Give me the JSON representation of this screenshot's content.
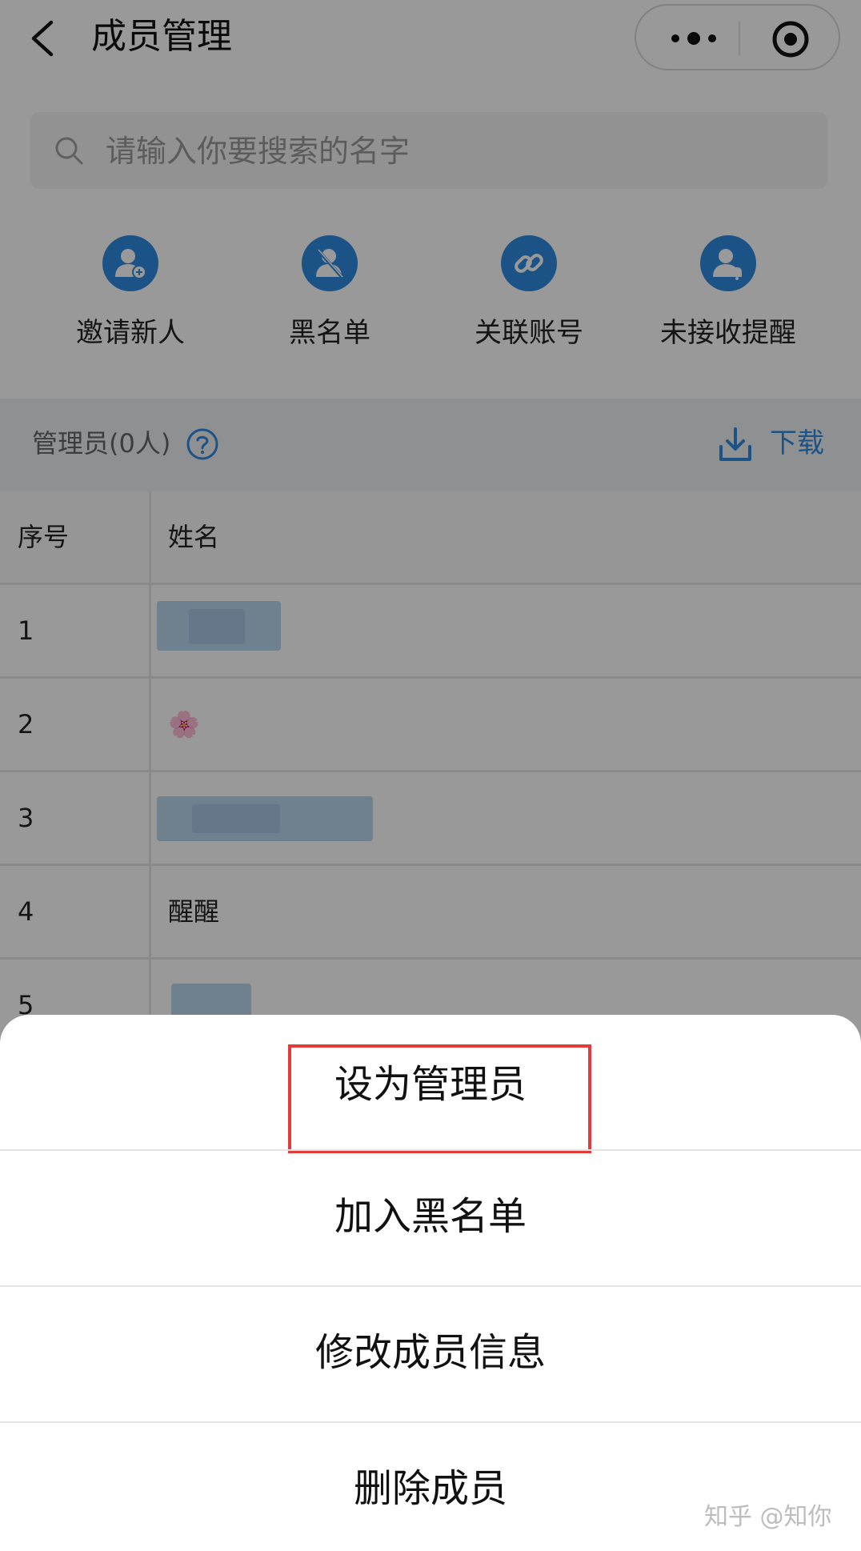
{
  "header": {
    "title": "成员管理"
  },
  "search": {
    "placeholder": "请输入你要搜索的名字"
  },
  "actions": [
    {
      "label": "邀请新人",
      "icon": "add-user-icon"
    },
    {
      "label": "黑名单",
      "icon": "blocked-user-icon"
    },
    {
      "label": "关联账号",
      "icon": "link-icon"
    },
    {
      "label": "未接收提醒",
      "icon": "user-bell-icon"
    }
  ],
  "admin": {
    "label": "管理员(0人)",
    "download_label": "下载"
  },
  "table": {
    "headers": [
      "序号",
      "姓名"
    ],
    "rows": [
      {
        "num": "1",
        "name": ""
      },
      {
        "num": "2",
        "name": "🌸"
      },
      {
        "num": "3",
        "name": ""
      },
      {
        "num": "4",
        "name": "醒醒"
      },
      {
        "num": "5",
        "name": ""
      }
    ]
  },
  "sheet": {
    "items": [
      "设为管理员",
      "加入黑名单",
      "修改成员信息",
      "删除成员"
    ]
  },
  "watermark": "知乎 @知你",
  "colors": {
    "accent": "#2f8ae0",
    "highlight": "#e23b3b",
    "overlay": "rgba(0,0,0,0.40)"
  }
}
